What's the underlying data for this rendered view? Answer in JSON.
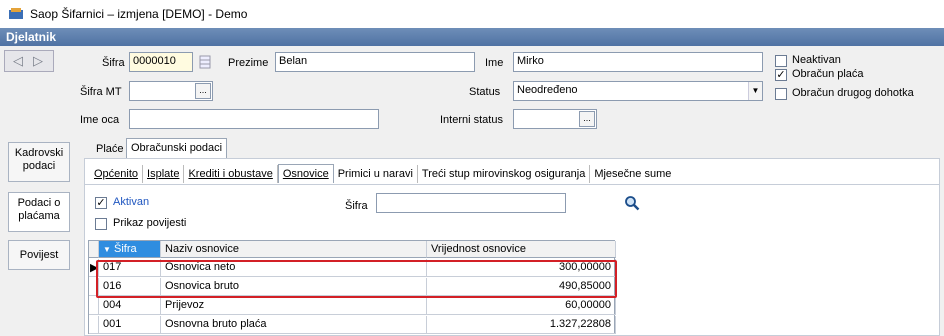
{
  "window": {
    "title": "Saop Šifarnici – izmjena  [DEMO] - Demo"
  },
  "header": {
    "title": "Djelatnik"
  },
  "form": {
    "sifra_label": "Šifra",
    "sifra_value": "0000010",
    "prezime_label": "Prezime",
    "prezime_value": "Belan",
    "ime_label": "Ime",
    "ime_value": "Mirko",
    "sifra_mt_label": "Šifra MT",
    "sifra_mt_value": "",
    "status_label": "Status",
    "status_value": "Neodređeno",
    "ime_oca_label": "Ime oca",
    "ime_oca_value": "",
    "interni_status_label": "Interni status",
    "interni_status_value": "",
    "dots": "...",
    "dd_arrow": "▼"
  },
  "checks": [
    {
      "label": "Neaktivan",
      "checked": false,
      "mark": ""
    },
    {
      "label": "Obračun plaća",
      "checked": true,
      "mark": "✓"
    },
    {
      "label": "Obračun drugog dohotka",
      "checked": false,
      "mark": ""
    }
  ],
  "side_buttons": [
    {
      "label": "Kadrovski podaci"
    },
    {
      "label": "Podaci o plaćama"
    },
    {
      "label": "Povijest"
    }
  ],
  "main_tabs": [
    {
      "label": "Plaće"
    },
    {
      "label": "Obračunski podaci"
    }
  ],
  "sub_tabs": [
    {
      "label": "Općenito"
    },
    {
      "label": "Isplate"
    },
    {
      "label": "Krediti i obustave"
    },
    {
      "label": "Osnovice"
    },
    {
      "label": "Primici u naravi"
    },
    {
      "label": "Treći stup mirovinskog osiguranja"
    },
    {
      "label": "Mjesečne sume"
    }
  ],
  "filters": {
    "aktivan_label": "Aktivan",
    "aktivan_mark": "✓",
    "prikaz_label": "Prikaz povijesti",
    "sifra_label": "Šifra",
    "sifra_value": ""
  },
  "grid": {
    "sort_arrow": "▼",
    "columns": [
      "Šifra",
      "Naziv osnovice",
      "Vrijednost osnovice"
    ],
    "rows": [
      {
        "sifra": "017",
        "naziv": "Osnovica neto",
        "vrijednost": "300,00000"
      },
      {
        "sifra": "016",
        "naziv": "Osnovica bruto",
        "vrijednost": "490,85000"
      },
      {
        "sifra": "004",
        "naziv": "Prijevoz",
        "vrijednost": "60,00000"
      },
      {
        "sifra": "001",
        "naziv": "Osnovna bruto plaća",
        "vrijednost": "1.327,22808"
      }
    ]
  },
  "colors": {
    "header": "#4f72a3",
    "sort_header": "#2f8de0",
    "highlight_box": "#d32026"
  }
}
